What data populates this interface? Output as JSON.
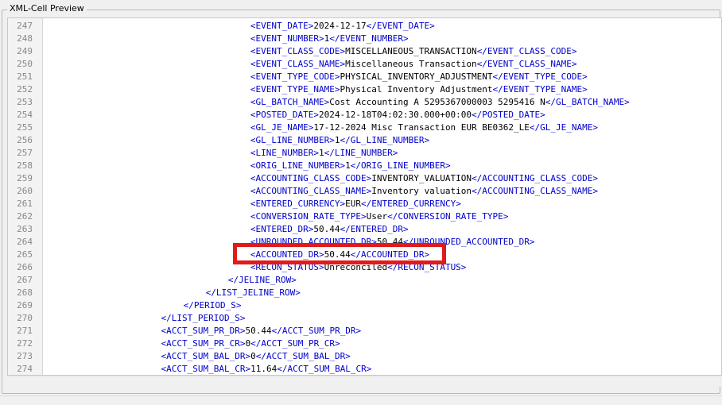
{
  "panel": {
    "title": "XML-Cell Preview"
  },
  "highlight_color": "#e01b1b",
  "lines": [
    {
      "num": "247",
      "indent": 9,
      "tag": "EVENT_DATE",
      "value": "2024-12-17",
      "kind": "element"
    },
    {
      "num": "248",
      "indent": 9,
      "tag": "EVENT_NUMBER",
      "value": "1",
      "kind": "element"
    },
    {
      "num": "249",
      "indent": 9,
      "tag": "EVENT_CLASS_CODE",
      "value": "MISCELLANEOUS_TRANSACTION",
      "kind": "element"
    },
    {
      "num": "250",
      "indent": 9,
      "tag": "EVENT_CLASS_NAME",
      "value": "Miscellaneous Transaction",
      "kind": "element"
    },
    {
      "num": "251",
      "indent": 9,
      "tag": "EVENT_TYPE_CODE",
      "value": "PHYSICAL_INVENTORY_ADJUSTMENT",
      "kind": "element"
    },
    {
      "num": "252",
      "indent": 9,
      "tag": "EVENT_TYPE_NAME",
      "value": "Physical Inventory Adjustment",
      "kind": "element"
    },
    {
      "num": "253",
      "indent": 9,
      "tag": "GL_BATCH_NAME",
      "value": "Cost Accounting A 5295367000003 5295416 N",
      "kind": "element"
    },
    {
      "num": "254",
      "indent": 9,
      "tag": "POSTED_DATE",
      "value": "2024-12-18T04:02:30.000+00:00",
      "kind": "element"
    },
    {
      "num": "255",
      "indent": 9,
      "tag": "GL_JE_NAME",
      "value": "17-12-2024 Misc Transaction EUR BE0362_LE",
      "kind": "element"
    },
    {
      "num": "256",
      "indent": 9,
      "tag": "GL_LINE_NUMBER",
      "value": "1",
      "kind": "element"
    },
    {
      "num": "257",
      "indent": 9,
      "tag": "LINE_NUMBER",
      "value": "1",
      "kind": "element"
    },
    {
      "num": "258",
      "indent": 9,
      "tag": "ORIG_LINE_NUMBER",
      "value": "1",
      "kind": "element"
    },
    {
      "num": "259",
      "indent": 9,
      "tag": "ACCOUNTING_CLASS_CODE",
      "value": "INVENTORY_VALUATION",
      "kind": "element"
    },
    {
      "num": "260",
      "indent": 9,
      "tag": "ACCOUNTING_CLASS_NAME",
      "value": "Inventory valuation",
      "kind": "element"
    },
    {
      "num": "261",
      "indent": 9,
      "tag": "ENTERED_CURRENCY",
      "value": "EUR",
      "kind": "element"
    },
    {
      "num": "262",
      "indent": 9,
      "tag": "CONVERSION_RATE_TYPE",
      "value": "User",
      "kind": "element"
    },
    {
      "num": "263",
      "indent": 9,
      "tag": "ENTERED_DR",
      "value": "50.44",
      "kind": "element"
    },
    {
      "num": "264",
      "indent": 9,
      "tag": "UNROUNDED_ACCOUNTED_DR",
      "value": "50.44",
      "kind": "element"
    },
    {
      "num": "265",
      "indent": 9,
      "tag": "ACCOUNTED_DR",
      "value": "50.44",
      "kind": "element",
      "highlighted": true
    },
    {
      "num": "266",
      "indent": 9,
      "tag": "RECON_STATUS",
      "value": "Unreconciled",
      "kind": "element"
    },
    {
      "num": "267",
      "indent": 8,
      "tag": "JELINE_ROW",
      "value": "",
      "kind": "close"
    },
    {
      "num": "268",
      "indent": 7,
      "tag": "LIST_JELINE_ROW",
      "value": "",
      "kind": "close"
    },
    {
      "num": "269",
      "indent": 6,
      "tag": "PERIOD_S",
      "value": "",
      "kind": "close"
    },
    {
      "num": "270",
      "indent": 5,
      "tag": "LIST_PERIOD_S",
      "value": "",
      "kind": "close"
    },
    {
      "num": "271",
      "indent": 5,
      "tag": "ACCT_SUM_PR_DR",
      "value": "50.44",
      "kind": "element"
    },
    {
      "num": "272",
      "indent": 5,
      "tag": "ACCT_SUM_PR_CR",
      "value": "0",
      "kind": "element"
    },
    {
      "num": "273",
      "indent": 5,
      "tag": "ACCT_SUM_BAL_DR",
      "value": "0",
      "kind": "element"
    },
    {
      "num": "274",
      "indent": 5,
      "tag": "ACCT_SUM_BAL_CR",
      "value": "11.64",
      "kind": "element"
    }
  ]
}
